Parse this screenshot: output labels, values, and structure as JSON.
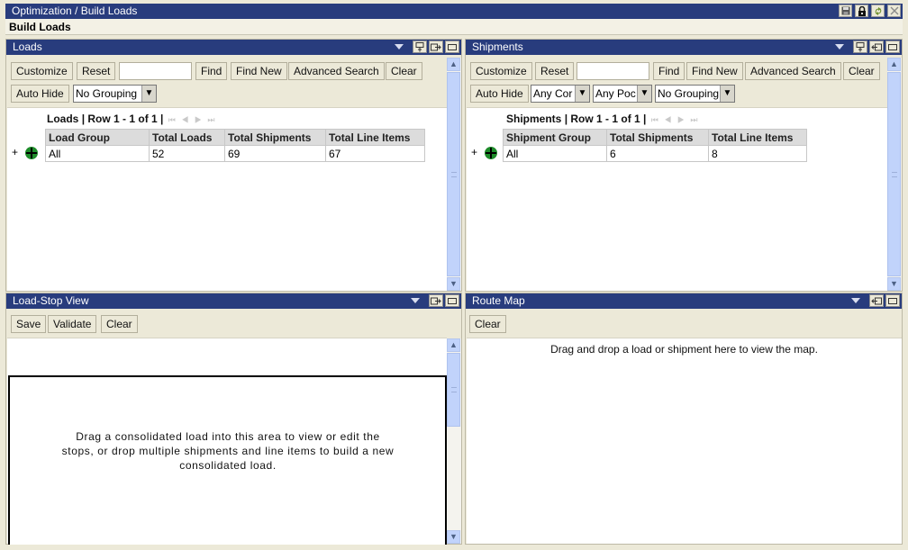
{
  "app": {
    "title": "Optimization / Build Loads",
    "subtitle": "Build Loads",
    "window_icons": [
      "save-icon",
      "lock-icon",
      "refresh-icon",
      "close-icon"
    ]
  },
  "loads_panel": {
    "title": "Loads",
    "toolbar": {
      "customize": "Customize",
      "reset": "Reset",
      "search_value": "",
      "find": "Find",
      "find_new": "Find New",
      "advanced_search": "Advanced Search",
      "clear": "Clear",
      "auto_hide": "Auto Hide",
      "grouping": "No Grouping"
    },
    "grid": {
      "caption_name": "Loads",
      "caption_rows": "| Row 1 - 1 of 1 |",
      "pager": "⏮ ◀ ▶ ⏭",
      "columns": [
        "Load Group",
        "Total Loads",
        "Total Shipments",
        "Total Line Items"
      ],
      "rows": [
        {
          "expand": "+",
          "cells": [
            "All",
            "52",
            "69",
            "67"
          ]
        }
      ]
    }
  },
  "shipments_panel": {
    "title": "Shipments",
    "toolbar": {
      "customize": "Customize",
      "reset": "Reset",
      "search_value": "",
      "find": "Find",
      "find_new": "Find New",
      "advanced_search": "Advanced Search",
      "clear": "Clear",
      "auto_hide": "Auto Hide",
      "filter1": "Any Cor",
      "filter2": "Any Poc",
      "grouping": "No Grouping"
    },
    "grid": {
      "caption_name": "Shipments",
      "caption_rows": "| Row 1 - 1 of 1 |",
      "pager": "⏮ ◀ ▶ ⏭",
      "columns": [
        "Shipment Group",
        "Total Shipments",
        "Total Line Items"
      ],
      "rows": [
        {
          "expand": "+",
          "cells": [
            "All",
            "6",
            "8"
          ]
        }
      ]
    }
  },
  "load_stop_panel": {
    "title": "Load-Stop View",
    "toolbar": {
      "save": "Save",
      "validate": "Validate",
      "clear": "Clear"
    },
    "message": "Drag a consolidated load into this area to view or edit the stops, or drop multiple shipments and line items to build a new consolidated load."
  },
  "route_map_panel": {
    "title": "Route Map",
    "toolbar": {
      "clear": "Clear"
    },
    "message": "Drag and drop a load or shipment here to view the map."
  },
  "glyphs": {
    "dropdown": "▼",
    "scroll_up": "⌃",
    "scroll_down": "⌄",
    "dock_out": "⇨",
    "dock_in": "⇦",
    "pin": "⊤"
  }
}
